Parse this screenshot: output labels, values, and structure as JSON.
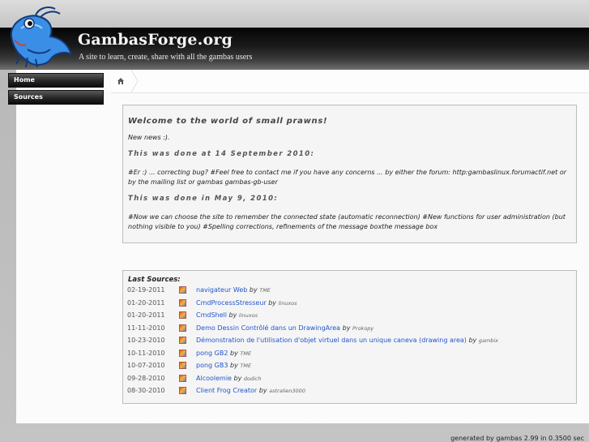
{
  "site": {
    "title": "GambasForge.org",
    "tagline": "A site to learn, create, share with all the gambas users"
  },
  "nav": {
    "items": [
      {
        "label": "Home"
      },
      {
        "label": "Sources"
      }
    ]
  },
  "welcome": {
    "heading": "Welcome to the world of small prawns!",
    "news": "New news :).",
    "date1": "This was done at 14 September 2010:",
    "text1": "#Er :) ... correcting bug? #Feel free to contact me if you have any concerns ... by either the forum:   http:gambaslinux.forumactif.net   or by the mailing list or gambas gambas-gb-user",
    "date2": "This was done in May 9, 2010:",
    "text2": "#Now we can choose the site to remember the connected state (automatic reconnection) #New functions for user administration (but nothing visible to you) #Spelling corrections, refinements of the message boxthe message box"
  },
  "sources": {
    "heading": "Last Sources:",
    "by_label": "by",
    "rows": [
      {
        "date": "02-19-2011",
        "title": "navigateur Web",
        "author": "TME"
      },
      {
        "date": "01-20-2011",
        "title": "CmdProcessStresseur",
        "author": "linuxos"
      },
      {
        "date": "01-20-2011",
        "title": "CmdShell",
        "author": "linuxos"
      },
      {
        "date": "11-11-2010",
        "title": "Demo Dessin Contrôlé dans un DrawingArea",
        "author": "Prokopy"
      },
      {
        "date": "10-23-2010",
        "title": "Démonstration de l'utilisation d'objet virtuel dans un unique caneva (drawing area)",
        "author": "gambix"
      },
      {
        "date": "10-11-2010",
        "title": "pong GB2",
        "author": "TME"
      },
      {
        "date": "10-07-2010",
        "title": "pong GB3",
        "author": "TME"
      },
      {
        "date": "09-28-2010",
        "title": "Alcoolemie",
        "author": "dodich"
      },
      {
        "date": "08-30-2010",
        "title": "Client Frog Creator",
        "author": "astralien3000"
      }
    ]
  },
  "footer": {
    "text": "generated by gambas 2.99 in 0.3500 sec"
  }
}
